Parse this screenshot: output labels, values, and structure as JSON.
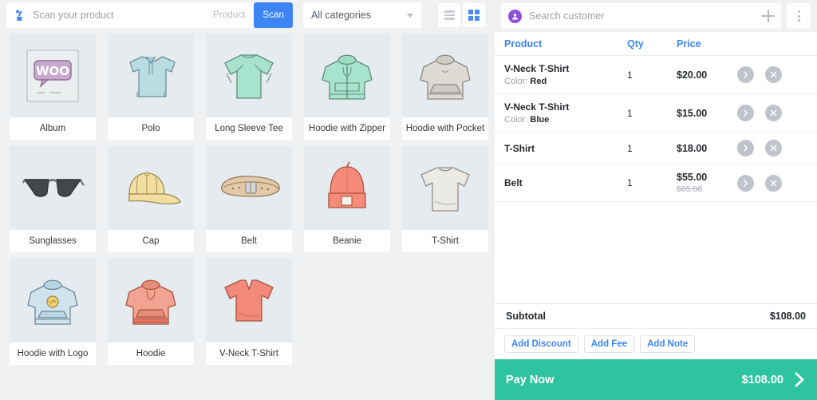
{
  "toolbar": {
    "scan_placeholder": "Scan your product",
    "scan_icon": "barcode-scanner-icon",
    "segment_product": "Product",
    "segment_scan": "Scan",
    "active_segment": "Scan",
    "category_selected": "All categories",
    "view_list_icon": "list-view-icon",
    "view_grid_icon": "grid-view-icon",
    "active_view": "grid",
    "accent_blue": "#3d85f5"
  },
  "products": [
    {
      "name": "Album",
      "art": "album"
    },
    {
      "name": "Polo",
      "art": "polo"
    },
    {
      "name": "Long Sleeve Tee",
      "art": "longsleeve"
    },
    {
      "name": "Hoodie with Zipper",
      "art": "hoodie-zip"
    },
    {
      "name": "Hoodie with Pocket",
      "art": "hoodie-pocket"
    },
    {
      "name": "Sunglasses",
      "art": "sunglasses"
    },
    {
      "name": "Cap",
      "art": "cap"
    },
    {
      "name": "Belt",
      "art": "belt"
    },
    {
      "name": "Beanie",
      "art": "beanie"
    },
    {
      "name": "T-Shirt",
      "art": "tshirt"
    },
    {
      "name": "Hoodie with Logo",
      "art": "hoodie-logo"
    },
    {
      "name": "Hoodie",
      "art": "hoodie"
    },
    {
      "name": "V-Neck T-Shirt",
      "art": "vneck"
    }
  ],
  "customer": {
    "search_placeholder": "Search customer",
    "avatar_icon": "customer-avatar-icon",
    "add_icon": "plus-icon",
    "menu_icon": "kebab-menu-icon"
  },
  "cart": {
    "columns": {
      "product": "Product",
      "qty": "Qty",
      "price": "Price"
    },
    "items": [
      {
        "name": "V-Neck T-Shirt",
        "meta_label": "Color:",
        "meta_value": "Red",
        "qty": "1",
        "price": "$20.00",
        "original_price": ""
      },
      {
        "name": "V-Neck T-Shirt",
        "meta_label": "Color:",
        "meta_value": "Blue",
        "qty": "1",
        "price": "$15.00",
        "original_price": ""
      },
      {
        "name": "T-Shirt",
        "meta_label": "",
        "meta_value": "",
        "qty": "1",
        "price": "$18.00",
        "original_price": ""
      },
      {
        "name": "Belt",
        "meta_label": "",
        "meta_value": "",
        "qty": "1",
        "price": "$55.00",
        "original_price": "$65.00"
      }
    ],
    "subtotal_label": "Subtotal",
    "subtotal_value": "$108.00",
    "add_discount": "Add Discount",
    "add_fee": "Add Fee",
    "add_note": "Add Note",
    "pay_label": "Pay Now",
    "pay_total": "$108.00",
    "pay_color": "#2ec4a0"
  }
}
